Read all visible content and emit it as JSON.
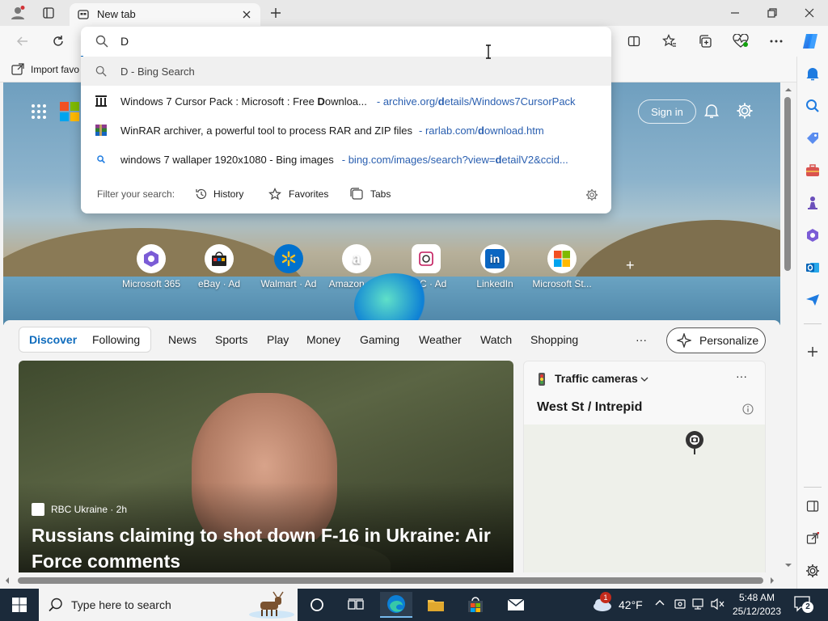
{
  "browser": {
    "tab_title": "New tab",
    "address_value": "D",
    "favorites_bar_text": "Import favo"
  },
  "omnibox": {
    "top_suggestion": "D - Bing Search",
    "suggestions": [
      {
        "title_pre": "Windows 7 Cursor Pack : Microsoft : Free ",
        "title_bold": "D",
        "title_post": "ownloa...",
        "url_pre": "- archive.org/",
        "url_bold": "d",
        "url_post": "etails/Windows7CursorPack"
      },
      {
        "title": "WinRAR archiver, a powerful tool to process RAR and ZIP files",
        "url_pre": "- rarlab.com/",
        "url_bold": "d",
        "url_post": "ownload.htm"
      },
      {
        "title": "windows 7 wallaper 1920x1080 - Bing images",
        "url_pre": "- bing.com/images/search?view=",
        "url_bold": "d",
        "url_post": "etailV2&ccid..."
      }
    ],
    "filter_label": "Filter your search:",
    "filter_history": "History",
    "filter_favorites": "Favorites",
    "filter_tabs": "Tabs"
  },
  "newtab": {
    "sign_in": "Sign in",
    "quick_links": [
      {
        "label": "Microsoft 365",
        "icon": "microsoft-365-icon"
      },
      {
        "label": "eBay · Ad",
        "icon": "ebay-icon"
      },
      {
        "label": "Walmart · Ad",
        "icon": "walmart-icon"
      },
      {
        "label": "Amazon · Ad",
        "icon": "amazon-icon"
      },
      {
        "label": "QVC · Ad",
        "icon": "qvc-icon"
      },
      {
        "label": "LinkedIn",
        "icon": "linkedin-icon"
      },
      {
        "label": "Microsoft St...",
        "icon": "microsoft-store-icon"
      }
    ]
  },
  "feed": {
    "tabs": [
      "Discover",
      "Following",
      "News",
      "Sports",
      "Play",
      "Money",
      "Gaming",
      "Weather",
      "Watch",
      "Shopping"
    ],
    "more": "···",
    "personalize": "Personalize",
    "hero_source": "RBC Ukraine · 2h",
    "hero_title": "Russians claiming to shot down F-16 in Ukraine: Air Force comments",
    "traffic_title": "Traffic cameras",
    "traffic_location": "West St / Intrepid",
    "traffic_more": "···"
  },
  "taskbar": {
    "search_placeholder": "Type here to search",
    "temperature": "42°F",
    "time": "5:48 AM",
    "date": "25/12/2023",
    "weather_badge": "1",
    "notification_count": "2"
  },
  "colors": {
    "accent": "#0f6cbd",
    "link": "#2a5fb0",
    "taskbar": "#1b2a3a"
  }
}
